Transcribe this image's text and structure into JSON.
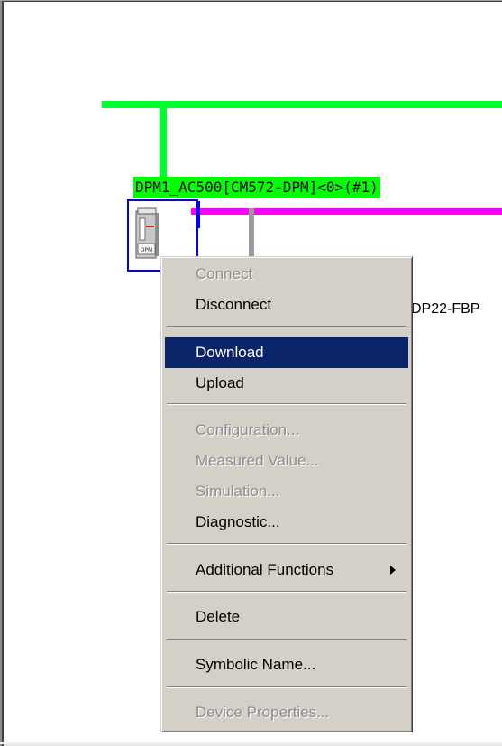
{
  "network": {
    "device_label": "DPM1_AC500[CM572-DPM]<0>(#1)",
    "side_device_label": "DP22-FBP",
    "device_icon_text": "DPM",
    "colors": {
      "profibus_line": "#00ff2e",
      "selection_box": "#0000ff",
      "secondary_bus": "#ff00ff",
      "connector": "#9a9a9a"
    }
  },
  "context_menu": {
    "items": [
      {
        "label": "Connect",
        "enabled": false
      },
      {
        "label": "Disconnect",
        "enabled": true
      },
      {
        "label": "Download",
        "enabled": true,
        "selected": true
      },
      {
        "label": "Upload",
        "enabled": true
      },
      {
        "label": "Configuration...",
        "enabled": false
      },
      {
        "label": "Measured Value...",
        "enabled": false
      },
      {
        "label": "Simulation...",
        "enabled": false
      },
      {
        "label": "Diagnostic...",
        "enabled": true
      },
      {
        "label": "Additional Functions",
        "enabled": true,
        "submenu": true,
        "submenu_icon": "chevron-right-icon"
      },
      {
        "label": "Delete",
        "enabled": true
      },
      {
        "label": "Symbolic Name...",
        "enabled": true
      },
      {
        "label": "Device Properties...",
        "enabled": false
      }
    ],
    "colors": {
      "background": "#d4d0c8",
      "highlight": "#0a246a",
      "disabled_text": "#8c8c8c"
    }
  }
}
